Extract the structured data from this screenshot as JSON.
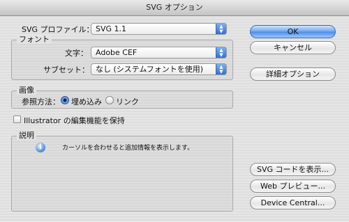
{
  "window": {
    "title": "SVG オプション"
  },
  "profile": {
    "label": "SVG プロファイル：",
    "value": "SVG 1.1"
  },
  "font_group": {
    "title": "フォント",
    "char_label": "文字：",
    "char_value": "Adobe CEF",
    "subset_label": "サブセット：",
    "subset_value": "なし (システムフォントを使用)"
  },
  "image_group": {
    "title": "画像",
    "ref_label": "参照方法：",
    "embed_label": "埋め込み",
    "link_label": "リンク",
    "selected": "embed"
  },
  "preserve": {
    "label": "Illustrator の編集機能を保持",
    "checked": false
  },
  "description": {
    "title": "説明",
    "text": "カーソルを合わせると追加情報を表示します。"
  },
  "buttons": {
    "ok": "OK",
    "cancel": "キャンセル",
    "detail": "詳細オプション",
    "svg_code": "SVG コードを表示...",
    "web_preview": "Web プレビュー...",
    "device_central": "Device Central..."
  }
}
